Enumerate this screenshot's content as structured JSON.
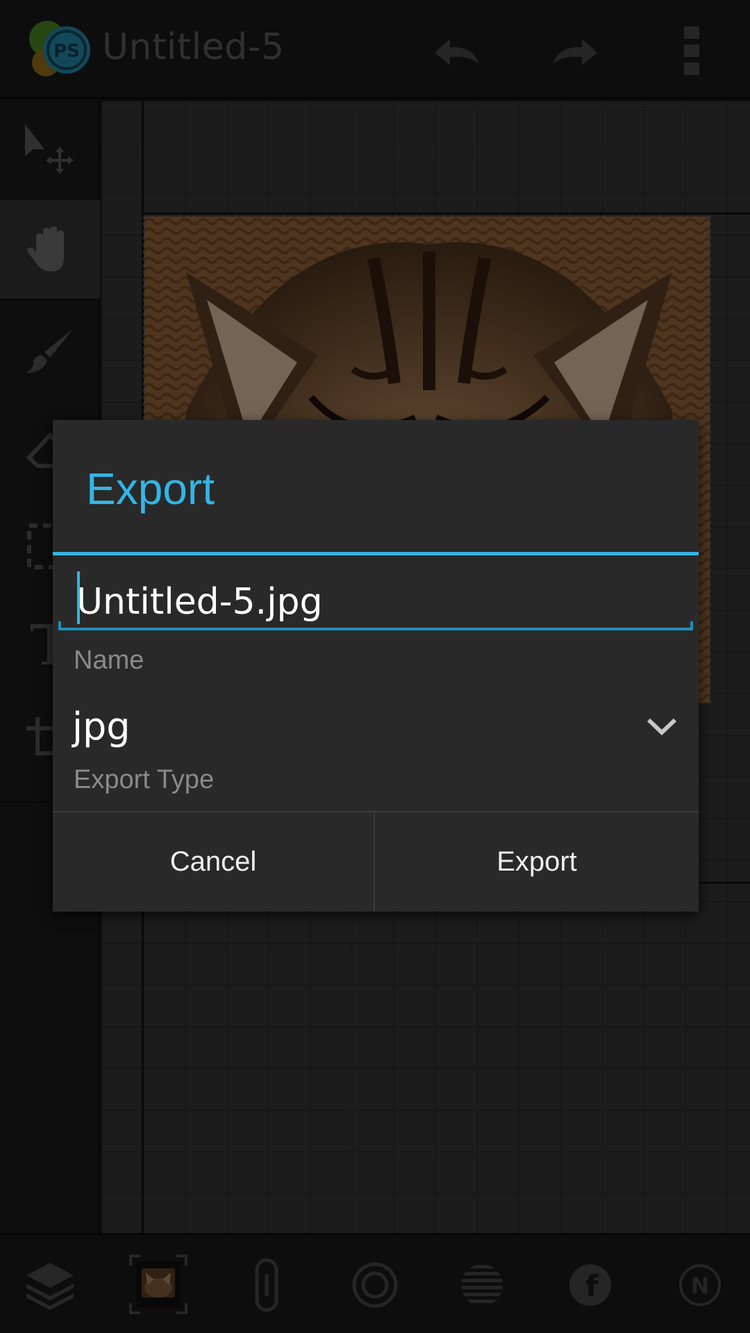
{
  "app": {
    "title": "Untitled-5",
    "logo_text": "PS"
  },
  "actionbar": {
    "undo_icon": "undo-icon",
    "redo_icon": "redo-icon",
    "overflow_icon": "more-vert-icon"
  },
  "toolbar": {
    "tools": [
      "move-icon",
      "hand-icon",
      "brush-icon",
      "eraser-icon",
      "selection-icon",
      "text-icon",
      "crop-icon"
    ],
    "active_tool": "hand-icon"
  },
  "bottombar": {
    "icons": [
      "layers-icon",
      "canvas-thumbnail",
      "link-icon",
      "circle-icon",
      "stripes-icon",
      "facebook-icon",
      "n-badge-icon"
    ],
    "n_badge_text": "N",
    "facebook_text": "f"
  },
  "dialog": {
    "title": "Export",
    "filename_value": "Untitled-5.jpg",
    "name_label": "Name",
    "export_type_value": "jpg",
    "export_type_label": "Export Type",
    "cancel_label": "Cancel",
    "export_label": "Export"
  },
  "colors": {
    "accent": "#33b5e5",
    "dialog_bg": "#292929",
    "label": "#8a8a8a"
  }
}
